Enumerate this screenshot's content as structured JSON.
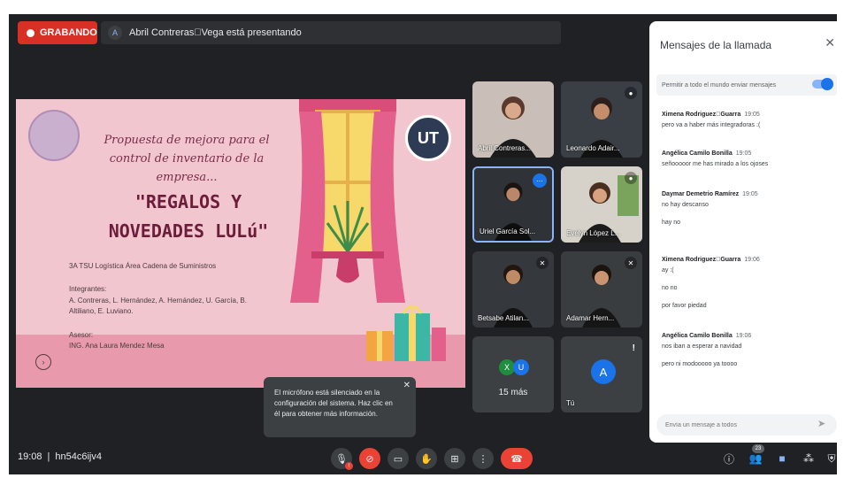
{
  "top": {
    "recording_label": "GRABANDO",
    "presenter_initial": "A",
    "presenter_text": "Abril Contreras\u0000Vega está presentando"
  },
  "slide": {
    "title": "Propuesta de mejora para el control de inventario de la empresa...",
    "brand_line1": "\"REGALOS Y",
    "brand_line2": "NOVEDADES LULú\"",
    "program": "3A TSU Logística Área Cadena de Suministros",
    "team_label": "Integrantes:",
    "team": "A. Contreras, L. Hernández, A. Hernández, U. García, B. Altiliano, E. Luviano.",
    "advisor_label": "Asesor:",
    "advisor": "ING. Ana Laura Mendez Mesa",
    "logo_text": "UT",
    "nav_icon": "chevron-right-icon"
  },
  "tiles": [
    {
      "name": "Abril Contreras..."
    },
    {
      "name": "Leonardo Adair..."
    },
    {
      "name": "Uriel García Sol..."
    },
    {
      "name": "Evelyn López L..."
    },
    {
      "name": "Betsabe Atilan..."
    },
    {
      "name": "Adamar Hern..."
    },
    {
      "name": "15 más",
      "avatars": [
        "X",
        "U"
      ]
    },
    {
      "name": "Tú",
      "avatar": "A"
    }
  ],
  "toast": {
    "text": "El micrófono está silenciado en la configuración del sistema. Haz clic en él para obtener más información."
  },
  "bottom": {
    "time": "19:08",
    "separator": "|",
    "meeting_code": "hn54c6ijv4",
    "mic_badge": "!",
    "participants_count": "23"
  },
  "chat": {
    "title": "Mensajes de la llamada",
    "permission": "Permitir a todo el mundo enviar mensajes",
    "messages": [
      {
        "author": "Ximena Rodriguez\u0000Guarra",
        "time": "19:05",
        "text": "pero va a haber más integradoras :("
      },
      {
        "author": "Angélica Camilo Bonilla",
        "time": "19:05",
        "text": "señooooor me has mirado a los ojoses"
      },
      {
        "author": "Daymar Demetrio Ramírez",
        "time": "19:05",
        "text": "no hay descanso",
        "text2": "hay no"
      },
      {
        "author": "Ximena Rodriguez\u0000Guarra",
        "time": "19:06",
        "text": "ay :(",
        "text2": "no no",
        "text3": "por favor piedad"
      },
      {
        "author": "Angélica Camilo Bonilla",
        "time": "19:06",
        "text": "nos iban a esperar a navidad",
        "text2": "pero ni modooooo ya toooo"
      }
    ],
    "input_placeholder": "Envía un mensaje a todos"
  },
  "colors": {
    "background": "#202124",
    "record": "#d93025",
    "accent": "#1a73e8",
    "end_call": "#ea4335"
  }
}
